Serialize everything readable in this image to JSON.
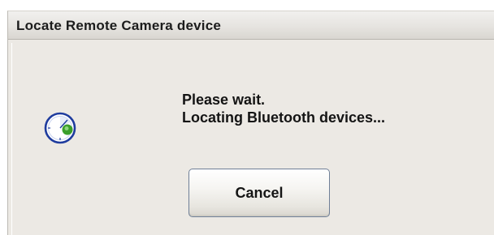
{
  "window": {
    "title": "Locate Remote Camera device"
  },
  "icons": {
    "status_icon": "bluetooth-search-icon"
  },
  "message": {
    "line1": "Please wait.",
    "line2": "Locating Bluetooth devices..."
  },
  "buttons": {
    "cancel_label": "Cancel"
  },
  "colors": {
    "dialog_bg": "#ece9e4",
    "icon_ring": "#1f3c9e",
    "icon_green": "#3a9e2a"
  }
}
